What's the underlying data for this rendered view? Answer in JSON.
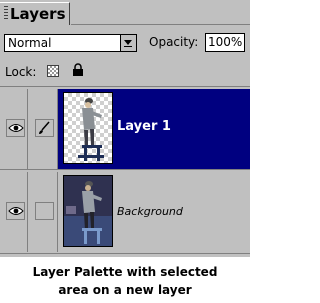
{
  "palette": {
    "tab_title": "Layers",
    "blend_mode": "Normal",
    "opacity_label": "Opacity:",
    "opacity_value": "100%",
    "lock_label": "Lock:"
  },
  "layers": [
    {
      "name": "Layer 1",
      "selected": true,
      "visible": true,
      "linked_icon": "brush-icon"
    },
    {
      "name": "Background",
      "selected": false,
      "visible": true,
      "linked_icon": ""
    }
  ],
  "caption": {
    "line1": "Layer Palette with selected",
    "line2": "area on a new layer"
  },
  "colors": {
    "panel": "#c0c0c0",
    "selection": "#000080"
  }
}
